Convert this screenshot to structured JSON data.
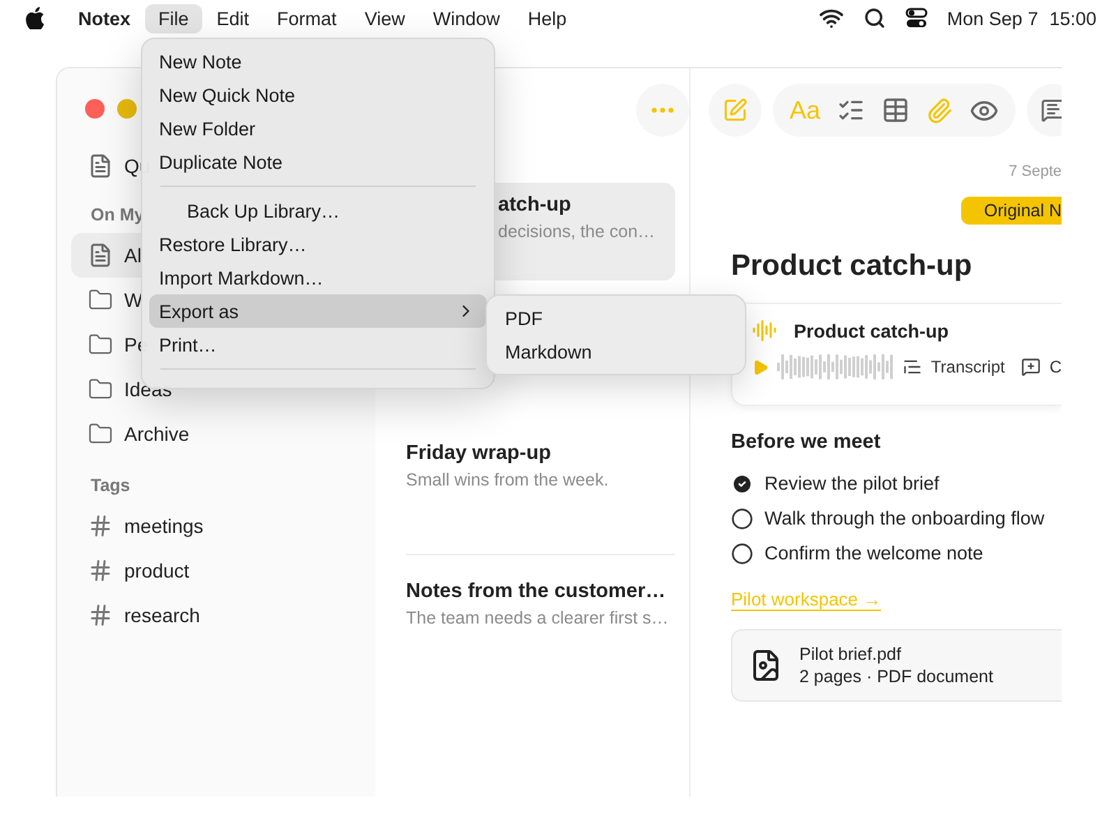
{
  "menu_bar": {
    "app_name": "Notex",
    "menus": [
      {
        "label": "File",
        "selected": true
      },
      {
        "label": "Edit",
        "selected": false
      },
      {
        "label": "Format",
        "selected": false
      },
      {
        "label": "View",
        "selected": false
      },
      {
        "label": "Window",
        "selected": false
      },
      {
        "label": "Help",
        "selected": false
      }
    ],
    "date": "Mon Sep 7",
    "time": "15:00"
  },
  "window": {
    "toolbar": {
      "format_label": "Aa"
    },
    "sidebar": {
      "top_item": "Qu",
      "section_label": "On My",
      "folders": [
        {
          "label": "Al",
          "kind": "notes",
          "selected": true
        },
        {
          "label": "W",
          "kind": "folder",
          "selected": false
        },
        {
          "label": "Pe",
          "kind": "folder",
          "selected": false
        },
        {
          "label": "Ideas",
          "kind": "folder",
          "selected": false
        },
        {
          "label": "Archive",
          "kind": "folder",
          "selected": false
        }
      ],
      "tags_label": "Tags",
      "tags": [
        {
          "label": "meetings"
        },
        {
          "label": "product"
        },
        {
          "label": "research"
        }
      ]
    },
    "note_list": [
      {
        "title": "atch-up",
        "preview": "decisions, the con…",
        "selected": true
      },
      {
        "title": "Friday wrap-up",
        "preview": "Small wins from the week.",
        "selected": false
      },
      {
        "title": "Notes from the customer…",
        "preview": "The team needs a clearer first s…",
        "selected": false
      }
    ],
    "editor": {
      "date": "7 Septe",
      "badge": "Original N",
      "title": "Product catch-up",
      "audio": {
        "title": "Product catch-up",
        "transcript": "Transcript",
        "comment": "C"
      },
      "heading": "Before we meet",
      "checklist": [
        {
          "label": "Review the pilot brief",
          "checked": true
        },
        {
          "label": "Walk through the onboarding flow",
          "checked": false
        },
        {
          "label": "Confirm the welcome note",
          "checked": false
        }
      ],
      "link": "Pilot workspace →",
      "attachment": {
        "name": "Pilot brief.pdf",
        "meta": "2 pages · PDF document"
      }
    }
  },
  "file_menu": {
    "items": [
      {
        "kind": "item",
        "label": "New Note",
        "selected": false
      },
      {
        "kind": "item",
        "label": "New Quick Note",
        "selected": false
      },
      {
        "kind": "item",
        "label": "New Folder",
        "selected": false
      },
      {
        "kind": "item",
        "label": "Duplicate Note",
        "selected": false
      },
      {
        "kind": "separator"
      },
      {
        "kind": "item",
        "label": "Back Up Library…",
        "selected": false,
        "indented": true
      },
      {
        "kind": "item",
        "label": "Restore Library…",
        "selected": false
      },
      {
        "kind": "item",
        "label": "Import Markdown…",
        "selected": false
      },
      {
        "kind": "item",
        "label": "Export as",
        "selected": true,
        "submenu": true
      },
      {
        "kind": "item",
        "label": "Print…",
        "selected": false
      },
      {
        "kind": "separator"
      }
    ],
    "submenu": [
      {
        "label": "PDF"
      },
      {
        "label": "Markdown"
      }
    ]
  }
}
